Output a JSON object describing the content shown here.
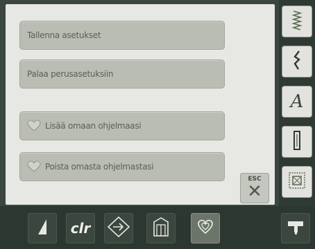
{
  "menu": {
    "save_settings": "Tallenna asetukset",
    "reset_defaults": "Palaa perusasetuksiin",
    "add_to_program": "Lisää omaan ohjelmaasi",
    "remove_from_program": "Poista omasta ohjelmastasi"
  },
  "esc": {
    "label": "ESC"
  },
  "bottom_bar": {
    "clr_label": "clr"
  },
  "sidebar": {
    "alphabet_label": "A"
  },
  "icons": {
    "heart": "heart-icon",
    "zigzag": "zigzag-stitch-icon",
    "stitch": "decorative-stitch-icon",
    "buttonhole": "buttonhole-icon",
    "quilt": "quilt-icon",
    "machine": "machine-icon",
    "tension": "tension-icon",
    "select": "select-icon",
    "memory": "memory-icon"
  },
  "colors": {
    "screen_bg": "#e7e7e3",
    "button_bg": "#b9bdb4",
    "frame_bg": "#3a463f"
  }
}
